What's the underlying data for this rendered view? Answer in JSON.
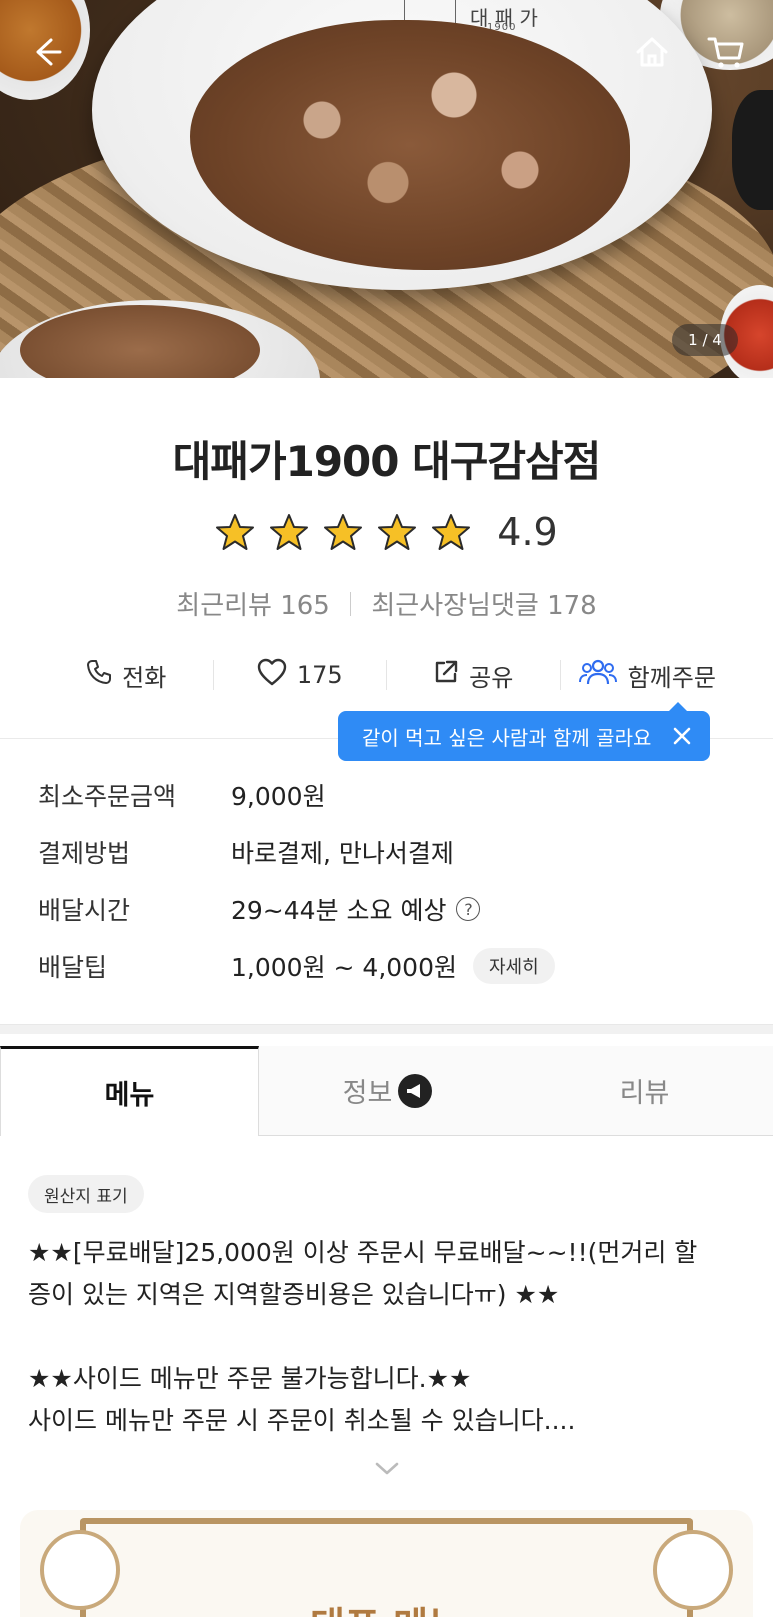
{
  "hero": {
    "pager": "1 / 4",
    "plate_logo": "대 패 가",
    "plate_logo_sub": "1900",
    "icons": [
      "back-arrow-icon",
      "home-icon",
      "cart-icon"
    ]
  },
  "store": {
    "name": "대패가1900 대구감삼점",
    "rating": "4.9",
    "star_count": 5,
    "recent_reviews": "최근리뷰 165",
    "owner_replies": "최근사장님댓글 178"
  },
  "actions": {
    "call": "전화",
    "like_count": "175",
    "share": "공유",
    "group_order": "함께주문"
  },
  "tooltip": {
    "text": "같이 먹고 싶은 사람과 함께 골라요",
    "color": "#2f8bf5"
  },
  "info": {
    "min_order_label": "최소주문금액",
    "min_order_value": "9,000원",
    "payment_label": "결제방법",
    "payment_value": "바로결제, 만나서결제",
    "delivery_time_label": "배달시간",
    "delivery_time_value": "29~44분 소요 예상",
    "delivery_tip_label": "배달팁",
    "delivery_tip_value": "1,000원 ~ 4,000원",
    "detail_button": "자세히"
  },
  "tabs": {
    "menu": "메뉴",
    "info": "정보",
    "review": "리뷰"
  },
  "notice": {
    "origin_button": "원산지 표기",
    "line1": "★★[무료배달]25,000원 이상 주문시 무료배달~~!!(먼거리 할",
    "line2": "증이 있는 지역은 지역할증비용은 있습니다ㅠ) ★★",
    "line3": "",
    "line4": "★★사이드 메뉴만 주문 불가능합니다.★★",
    "line5": "사이드 메뉴만 주문 시 주문이 취소될 수 있습니다...."
  },
  "banner": {
    "title": "대표 메뉴"
  }
}
